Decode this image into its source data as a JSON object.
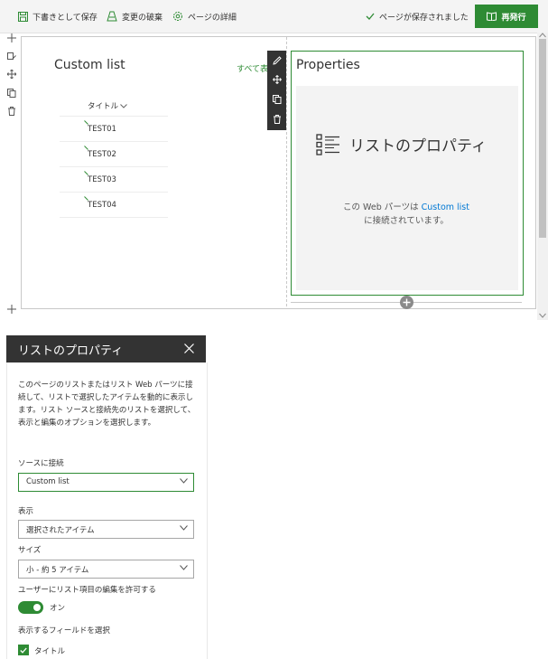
{
  "toolbar": {
    "save_draft": "下書きとして保存",
    "discard": "変更の破棄",
    "page_details": "ページの詳細",
    "saved_status": "ページが保存されました",
    "republish": "再発行"
  },
  "canvas": {
    "list_title": "Custom list",
    "see_all": "すべて表示",
    "column_header": "タイトル",
    "rows": [
      "TEST01",
      "TEST02",
      "TEST03",
      "TEST04"
    ]
  },
  "properties_webpart": {
    "title": "Properties",
    "heading": "リストのプロパティ",
    "desc_before": "この Web パーツは ",
    "desc_link": "Custom list",
    "desc_after": "に接続されています。"
  },
  "pane": {
    "title": "リストのプロパティ",
    "description": "このページのリストまたはリスト Web パーツに接続して、リストで選択したアイテムを動的に表示します。リスト ソースと接続先のリストを選択して、表示と編集のオプションを選択します。",
    "source_label": "ソースに接続",
    "source_value": "Custom list",
    "display_label": "表示",
    "display_value": "選択されたアイテム",
    "size_label": "サイズ",
    "size_value": "小 - 約 5 アイテム",
    "edit_label": "ユーザーにリスト項目の編集を許可する",
    "toggle_state": "オン",
    "fields_label": "表示するフィールドを選択",
    "field_title": "タイトル"
  },
  "colors": {
    "accent": "#2e8b34",
    "link": "#0078d4",
    "pane_header": "#333333"
  }
}
